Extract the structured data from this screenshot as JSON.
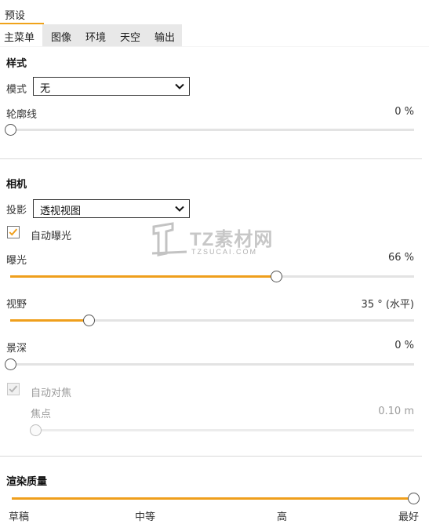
{
  "header": {
    "preset_tab": "预设",
    "tabs": [
      "主菜单",
      "图像",
      "环境",
      "天空",
      "输出"
    ],
    "active_tab_index": 0
  },
  "style_section": {
    "title": "样式",
    "mode_label": "模式",
    "mode_value": "无",
    "outline_label": "轮廓线",
    "outline_value": "0 %",
    "outline_level": 0
  },
  "camera_section": {
    "title": "相机",
    "projection_label": "投影",
    "projection_value": "透视视图",
    "auto_exposure_label": "自动曝光",
    "auto_exposure_checked": true,
    "exposure_label": "曝光",
    "exposure_value": "66 %",
    "exposure_level": 0.66,
    "fov_label": "视野",
    "fov_value": "35 ° (水平)",
    "fov_level": 0.195,
    "dof_label": "景深",
    "dof_value": "0 %",
    "dof_level": 0,
    "auto_focus_label": "自动对焦",
    "auto_focus_checked": true,
    "auto_focus_disabled": true,
    "focus_label": "焦点",
    "focus_value": "0.10  m",
    "focus_level": 0
  },
  "render_quality": {
    "title": "渲染质量",
    "level": 1.0,
    "ticks": [
      "草稿",
      "中等",
      "高",
      "最好"
    ]
  },
  "watermark": {
    "title": "TZ素材网",
    "subtitle": "TZSUCAI.COM"
  },
  "colors": {
    "accent": "#ef9f1c",
    "track": "#e3e3e3",
    "tab_bar": "#e8e8e8",
    "disabled_text": "#9b9b9b"
  }
}
